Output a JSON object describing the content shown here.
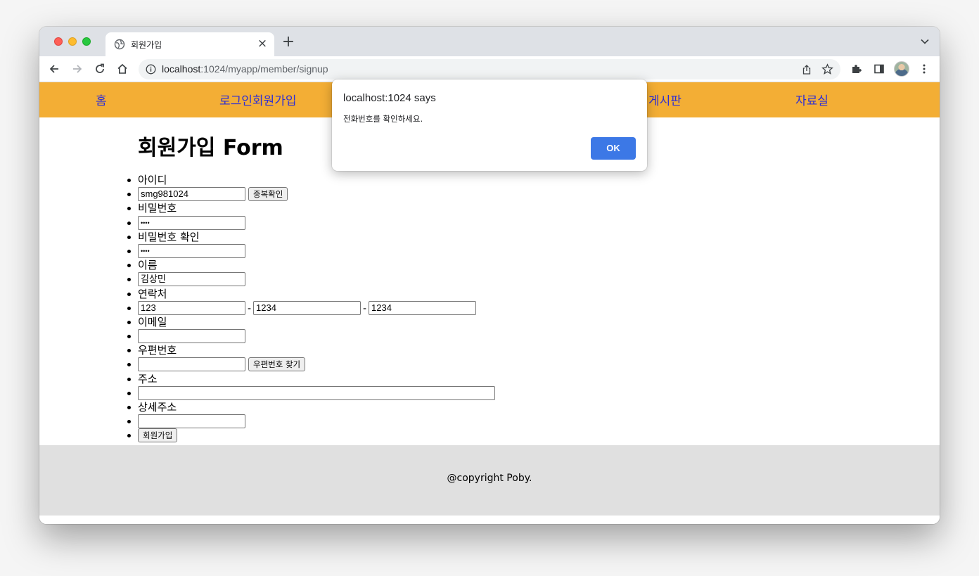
{
  "browser": {
    "tab_title": "회원가입",
    "url_host": "localhost",
    "url_path": ":1024/myapp/member/signup"
  },
  "nav": {
    "items": [
      "홈",
      "로그인회원가입",
      "게시판",
      "자료실"
    ]
  },
  "form": {
    "title": "회원가입 Form",
    "id_label": "아이디",
    "id_value": "smg981024",
    "dup_check_label": "중복확인",
    "pw_label": "비밀번호",
    "pw_value": "••••",
    "pw_confirm_label": "비밀번호 확인",
    "pw_confirm_value": "••••",
    "name_label": "이름",
    "name_value": "김상민",
    "phone_label": "연락처",
    "phone1": "123",
    "phone2": "1234",
    "phone3": "1234",
    "phone_separator": "-",
    "email_label": "이메일",
    "email_value": "",
    "zip_label": "우편번호",
    "zip_value": "",
    "zip_search_label": "우편번호 찾기",
    "address_label": "주소",
    "address_value": "",
    "detail_address_label": "상세주소",
    "detail_address_value": "",
    "submit_label": "회원가입"
  },
  "footer": {
    "copyright": "@copyright Poby."
  },
  "dialog": {
    "title": "localhost:1024 says",
    "message": "전화번호를 확인하세요.",
    "ok_label": "OK"
  },
  "colors": {
    "nav_bg": "#f3ae35",
    "nav_link": "#2d2ed6",
    "footer_bg": "#e0e0e0",
    "ok_button": "#3c78e6"
  }
}
